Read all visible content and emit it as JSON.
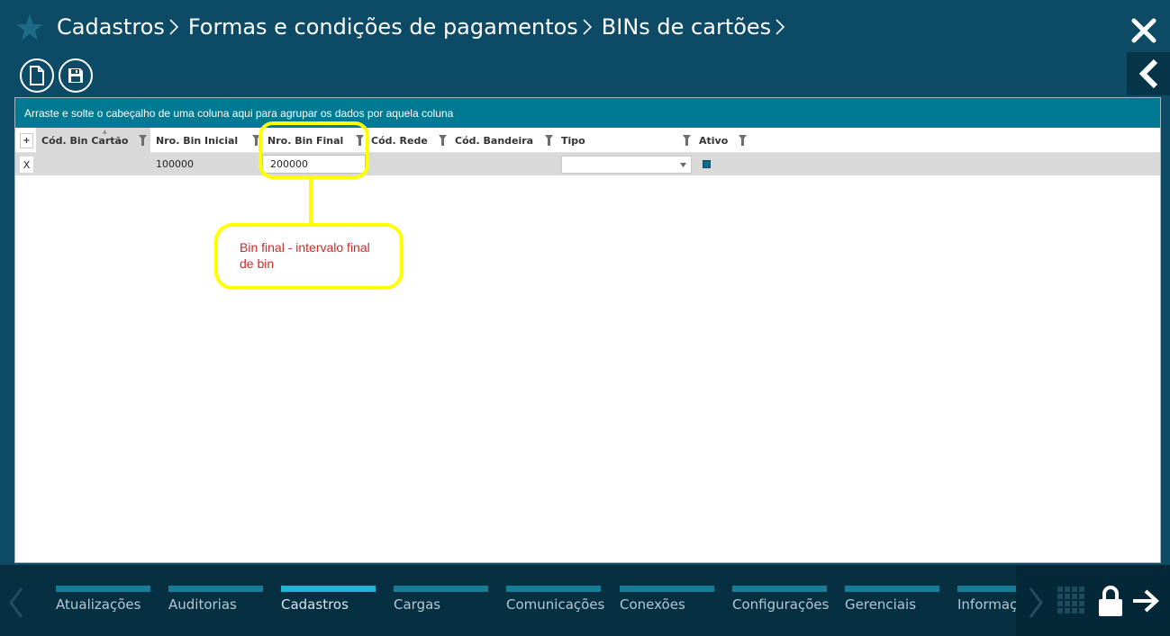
{
  "header": {
    "breadcrumb": [
      "Cadastros",
      "Formas e condições de pagamentos",
      "BINs de cartões"
    ]
  },
  "grid": {
    "group_hint": "Arraste e solte o cabeçalho de uma coluna aqui para agrupar os dados por aquela coluna",
    "expand_symbol": "+",
    "columns": [
      "Cód. Bin Cartão",
      "Nro. Bin Inicial",
      "Nro. Bin Final",
      "Cód. Rede",
      "Cód. Bandeira",
      "Tipo",
      "Ativo"
    ],
    "rows": [
      {
        "delete_symbol": "X",
        "cod_bin_cartao": "",
        "nro_bin_inicial": "100000",
        "nro_bin_final": "200000",
        "cod_rede": "",
        "cod_bandeira": "",
        "tipo": "",
        "ativo": true
      }
    ]
  },
  "annotation": {
    "text_line1": "Bin final - intervalo final",
    "text_line2": "de bin",
    "color": "#ffff00",
    "text_color": "#cc2a2a"
  },
  "bottom_nav": {
    "items": [
      "Atualizações",
      "Auditorias",
      "Cadastros",
      "Cargas",
      "Comunicações",
      "Conexões",
      "Configurações",
      "Gerenciais",
      "Informações"
    ],
    "active_index": 2
  },
  "icons": {
    "star": "star-icon",
    "close": "close-icon",
    "new_document": "new-document-icon",
    "save": "floppy-disk-icon",
    "collapse": "chevron-left-icon",
    "filter": "filter-icon",
    "apps": "grid-apps-icon",
    "lock": "lock-icon",
    "exit": "arrow-right-icon"
  },
  "colors": {
    "background": "#0c4a66",
    "group_bar": "#007a93",
    "nav_active": "#1fb6d3",
    "nav_inactive": "#167d96"
  }
}
